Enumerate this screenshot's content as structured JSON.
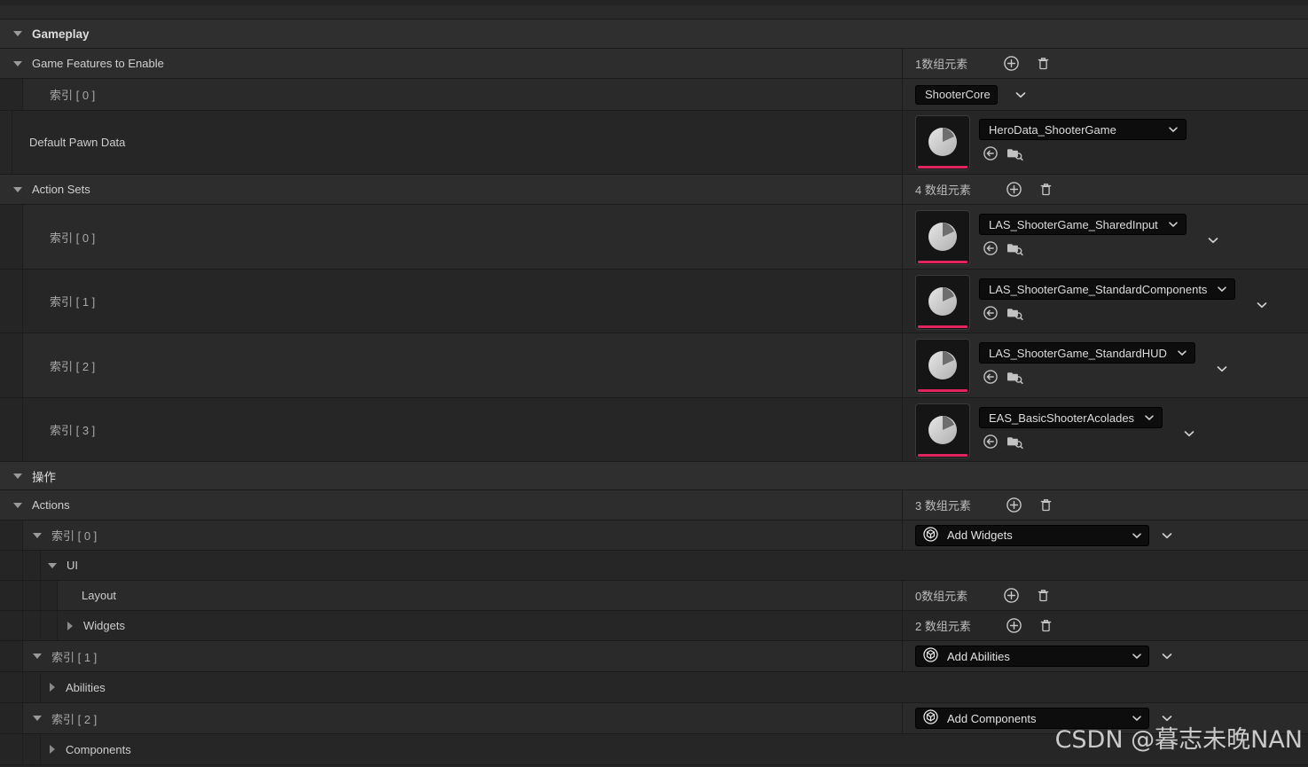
{
  "sections": {
    "gameplay": {
      "label": "Gameplay"
    },
    "operations": {
      "label": "操作"
    }
  },
  "rows": {
    "game_features": {
      "label": "Game Features to Enable",
      "count": "1数组元素",
      "add_tooltip": "add-element",
      "delete_tooltip": "delete-elements"
    },
    "gf_index0": {
      "label": "索引 [ 0 ]",
      "value": "ShooterCore"
    },
    "default_pawn_data": {
      "label": "Default Pawn Data",
      "value": "HeroData_ShooterGame"
    },
    "action_sets": {
      "label": "Action Sets",
      "count": "4 数组元素"
    },
    "as_index0": {
      "label": "索引 [ 0 ]",
      "value": "LAS_ShooterGame_SharedInput"
    },
    "as_index1": {
      "label": "索引 [ 1 ]",
      "value": "LAS_ShooterGame_StandardComponents"
    },
    "as_index2": {
      "label": "索引 [ 2 ]",
      "value": "LAS_ShooterGame_StandardHUD"
    },
    "as_index3": {
      "label": "索引 [ 3 ]",
      "value": "EAS_BasicShooterAcolades"
    },
    "actions": {
      "label": "Actions",
      "count": "3 数组元素"
    },
    "act_index0": {
      "label": "索引 [ 0 ]",
      "value": "Add Widgets"
    },
    "act_ui": {
      "label": "UI"
    },
    "act_layout": {
      "label": "Layout",
      "count": "0数组元素"
    },
    "act_widgets": {
      "label": "Widgets",
      "count": "2 数组元素"
    },
    "act_index1": {
      "label": "索引 [ 1 ]",
      "value": "Add Abilities"
    },
    "act_abilities": {
      "label": "Abilities"
    },
    "act_index2": {
      "label": "索引 [ 2 ]",
      "value": "Add Components"
    },
    "act_components": {
      "label": "Components"
    }
  },
  "icons": {
    "expander_open": "triangle-down-icon",
    "expander_closed": "triangle-right-icon",
    "add": "add-circle-icon",
    "delete": "trash-icon",
    "use_selected": "use-selected-asset-icon",
    "browse": "browse-asset-icon",
    "dropdown": "chevron-down-icon",
    "class_picker": "cube-icon",
    "thumbnail": "asset-thumbnail-icon"
  },
  "colors": {
    "accent_pink": "#e0245e",
    "row_dark": "#2a2a2a",
    "row_darker": "#262626",
    "category": "#2f2f2f",
    "combo_bg": "#0d0d0d",
    "text": "#c8c8c8"
  },
  "watermark": {
    "text": "CSDN @暮志未晚NAN"
  }
}
